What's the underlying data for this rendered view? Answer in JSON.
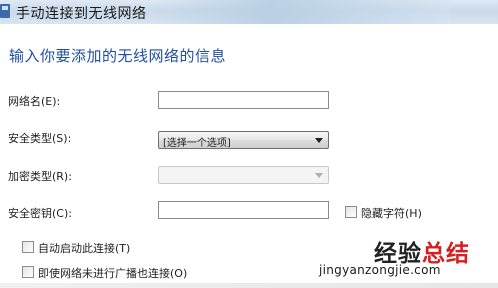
{
  "window": {
    "title": "手动连接到无线网络",
    "icon": "network-wizard-icon"
  },
  "heading": "输入你要添加的无线网络的信息",
  "form": {
    "network_name": {
      "label": "网络名(E):",
      "value": ""
    },
    "security_type": {
      "label": "安全类型(S):",
      "value": "[选择一个选项]"
    },
    "encryption_type": {
      "label": "加密类型(R):",
      "value": ""
    },
    "security_key": {
      "label": "安全密钥(C):",
      "value": ""
    },
    "hide_chars": {
      "label": "隐藏字符(H)",
      "checked": false
    }
  },
  "options": [
    {
      "label": "自动启动此连接(T)",
      "checked": false
    },
    {
      "label": "即使网络未进行广播也连接(O)",
      "checked": false
    }
  ],
  "watermark": {
    "cn_part1": "经验",
    "cn_part2": "总结",
    "url": "jingyanzongjie.com"
  },
  "colors": {
    "heading": "#1f4fa5",
    "watermark_red": "#d32020",
    "titlebar": "#c9daea"
  }
}
